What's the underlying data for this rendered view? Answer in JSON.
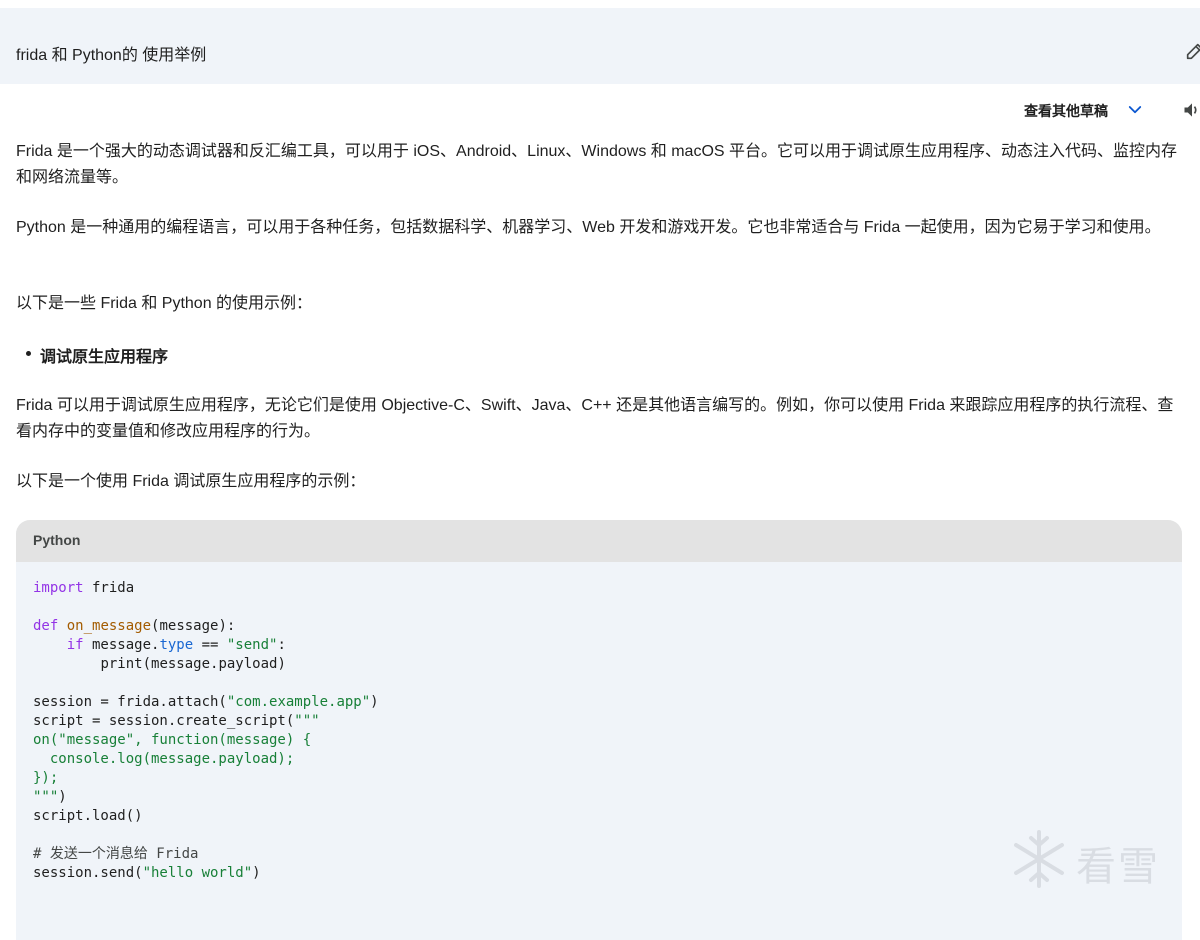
{
  "prompt": {
    "text": "frida 和 Python的 使用举例"
  },
  "drafts": {
    "label": "查看其他草稿"
  },
  "response": {
    "paragraphs": [
      "Frida 是一个强大的动态调试器和反汇编工具，可以用于 iOS、Android、Linux、Windows 和 macOS 平台。它可以用于调试原生应用程序、动态注入代码、监控内存和网络流量等。",
      "Python 是一种通用的编程语言，可以用于各种任务，包括数据科学、机器学习、Web 开发和游戏开发。它也非常适合与 Frida 一起使用，因为它易于学习和使用。",
      "以下是一些 Frida 和 Python 的使用示例：",
      "Frida 可以用于调试原生应用程序，无论它们是使用 Objective-C、Swift、Java、C++ 还是其他语言编写的。例如，你可以使用 Frida 来跟踪应用程序的执行流程、查看内存中的变量值和修改应用程序的行为。",
      "以下是一个使用 Frida 调试原生应用程序的示例："
    ],
    "bullet": "调试原生应用程序"
  },
  "code": {
    "language": "Python",
    "lines": {
      "l1_kw": "import",
      "l1_rest": " frida",
      "l3_kw": "def",
      "l3_fn": "on_message",
      "l3_rest": "(message):",
      "l4_kw": "if",
      "l4_mid": " message.",
      "l4_attr": "type",
      "l4_op": " == ",
      "l4_str": "\"send\"",
      "l4_end": ":",
      "l5": "print(message.payload)",
      "l7_pre": "session = frida.attach(",
      "l7_str": "\"com.example.app\"",
      "l7_end": ")",
      "l8_pre": "script = session.create_script(",
      "l8_str": "\"\"\"",
      "l9": "on(\"message\", function(message) {",
      "l10": "  console.log(message.payload);",
      "l11": "});",
      "l12_str": "\"\"\"",
      "l12_end": ")",
      "l13": "script.load()",
      "l15": "# 发送一个消息给 Frida",
      "l16_pre": "session.send(",
      "l16_str": "\"hello world\"",
      "l16_end": ")"
    }
  },
  "watermark": {
    "text": "看雪"
  },
  "icons": [
    "edit-icon",
    "chevron-down-icon",
    "speaker-icon",
    "snowflake-logo"
  ],
  "colors": {
    "prompt_bg": "#f0f4f9",
    "code_bg": "#f0f4f9",
    "code_header_bg": "#e3e3e3",
    "keyword": "#9334e6",
    "string": "#188038",
    "function": "#a35b00",
    "attribute": "#1967d2"
  }
}
